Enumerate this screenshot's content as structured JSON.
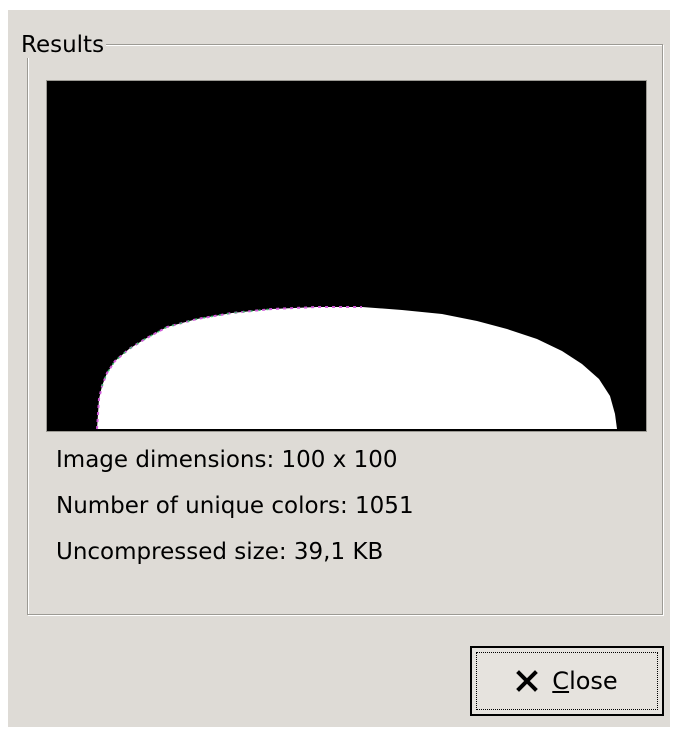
{
  "frame": {
    "title": "Results"
  },
  "preview": {
    "description_colors": {
      "background": "#000000",
      "shape": "#ffffff"
    }
  },
  "info": {
    "dimensions": "Image dimensions: 100 x 100",
    "unique_colors": "Number of unique colors: 1051",
    "uncompressed_size": "Uncompressed size: 39,1 KB"
  },
  "buttons": {
    "close": {
      "mnemonic": "C",
      "rest": "lose",
      "icon": "close-icon"
    }
  }
}
